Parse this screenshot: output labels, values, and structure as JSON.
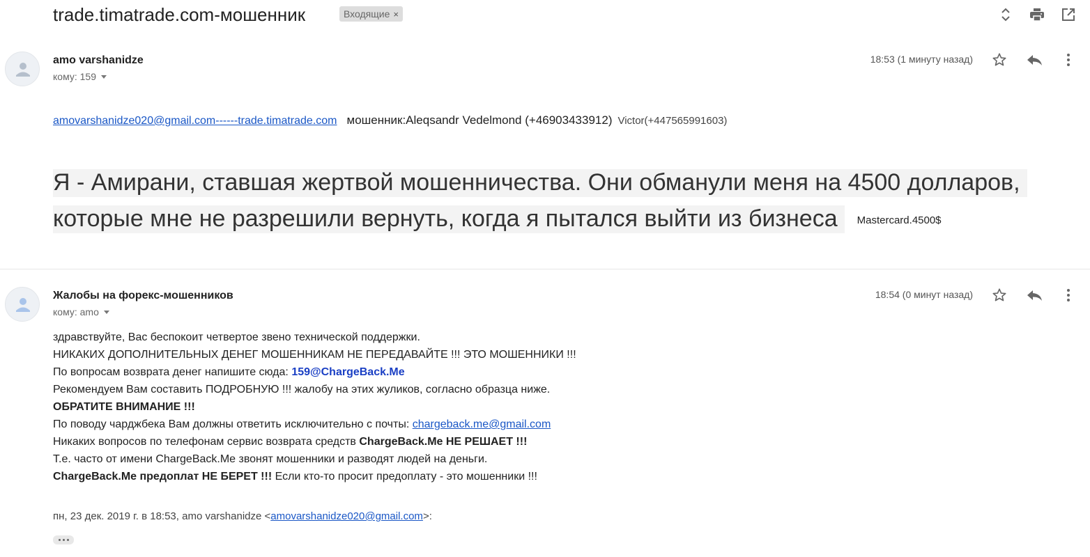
{
  "header": {
    "subject": "trade.timatrade.com-мошенник",
    "label": "Входящие",
    "label_remove": "×",
    "icons": [
      "expand-collapse-icon",
      "print-icon",
      "open-in-new-window-icon"
    ]
  },
  "messages": [
    {
      "sender": "amo varshanidze",
      "recipient": "кому: 159",
      "time": "18:53 (1 минуту назад)",
      "actions": [
        "star-icon",
        "reply-icon",
        "more-icon"
      ],
      "body": {
        "link": "amovarshanidze020@gmail.com------trade.timatrade.com",
        "fraud_text": "мошенник:Aleqsandr Vedelmond (+46903433912)",
        "victor_text": "Victor(+447565991603)",
        "big_text": "Я - Амирани, ставшая жертвой мошенничества. Они обманули меня на 4500 долларов, которые мне не разрешили вернуть, когда я пытался выйти из бизнеса",
        "payment": "Mastercard.4500$"
      }
    },
    {
      "sender": "Жалобы на форекс-мошенников",
      "recipient": "кому: amo",
      "time": "18:54 (0 минут назад)",
      "actions": [
        "star-icon",
        "reply-icon",
        "more-icon"
      ],
      "body": {
        "l1": "здравствуйте, Вас беспокоит четвертое звено технической поддержки.",
        "l2": "НИКАКИХ ДОПОЛНИТЕЛЬНЫХ ДЕНЕГ МОШЕННИКАМ НЕ ПЕРЕДАВАЙТЕ !!! ЭТО МОШЕННИКИ !!!",
        "l3_pre": "По вопросам возврата денег напишите сюда: ",
        "l3_email": "159@ChargeBack.Me",
        "l4": "Рекомендуем Вам составить ПОДРОБНУЮ !!! жалобу на этих жуликов, согласно образца ниже.",
        "l5": "ОБРАТИТЕ ВНИМАНИЕ !!!",
        "l6_pre": "По поводу чарджбека Вам должны ответить исключительно с почты: ",
        "l6_link": "chargeback.me@gmail.com",
        "l7_pre": "Никаких вопросов по телефонам сервис возврата средств ",
        "l7_bold": "ChargeBack.Me НЕ РЕШАЕТ !!!",
        "l8": "Т.е. часто от имени ChargeBack.Me звонят мошенники и разводят людей на деньги.",
        "l9_bold": "ChargeBack.Me предоплат НЕ БЕРЕТ !!!",
        "l9_rest": " Если кто-то просит предоплату - это мошенники !!!"
      },
      "quote": {
        "pre": "пн, 23 дек. 2019 г. в 18:53, amo varshanidze <",
        "email": "amovarshanidze020@gmail.com",
        "post": ">:"
      }
    }
  ]
}
